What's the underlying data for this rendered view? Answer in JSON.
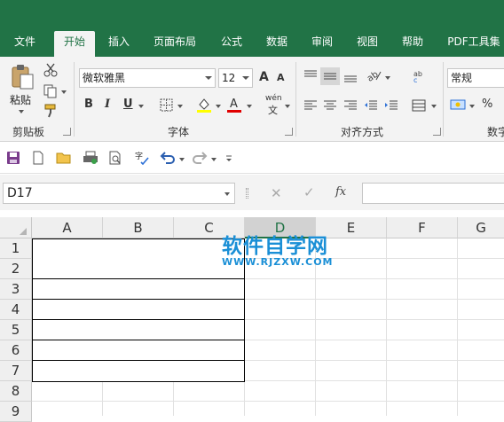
{
  "ribbon_tabs": [
    "文件",
    "开始",
    "插入",
    "页面布局",
    "公式",
    "数据",
    "审阅",
    "视图",
    "帮助",
    "PDF工具集"
  ],
  "active_tab": "开始",
  "clipboard": {
    "paste_label": "粘贴",
    "group_label": "剪贴板"
  },
  "font": {
    "family": "微软雅黑",
    "size": "12",
    "group_label": "字体",
    "bold": "B",
    "italic": "I",
    "underline": "U",
    "grow": "A",
    "shrink": "A",
    "phonetic": "wén"
  },
  "alignment": {
    "group_label": "对齐方式"
  },
  "number": {
    "format": "常规",
    "group_label": "数字",
    "percent": "%"
  },
  "formula_bar": {
    "name_box": "D17",
    "fx": "fx",
    "value": ""
  },
  "columns": [
    "A",
    "B",
    "C",
    "D",
    "E",
    "F",
    "G"
  ],
  "selected_column": "D",
  "rows": [
    "1",
    "2",
    "3",
    "4",
    "5",
    "6",
    "7",
    "8",
    "9"
  ],
  "watermark": {
    "title": "软件自学网",
    "url": "WWW.RJZXW.COM"
  },
  "colors": {
    "accent": "#217346",
    "watermark": "#1a8fd6"
  }
}
